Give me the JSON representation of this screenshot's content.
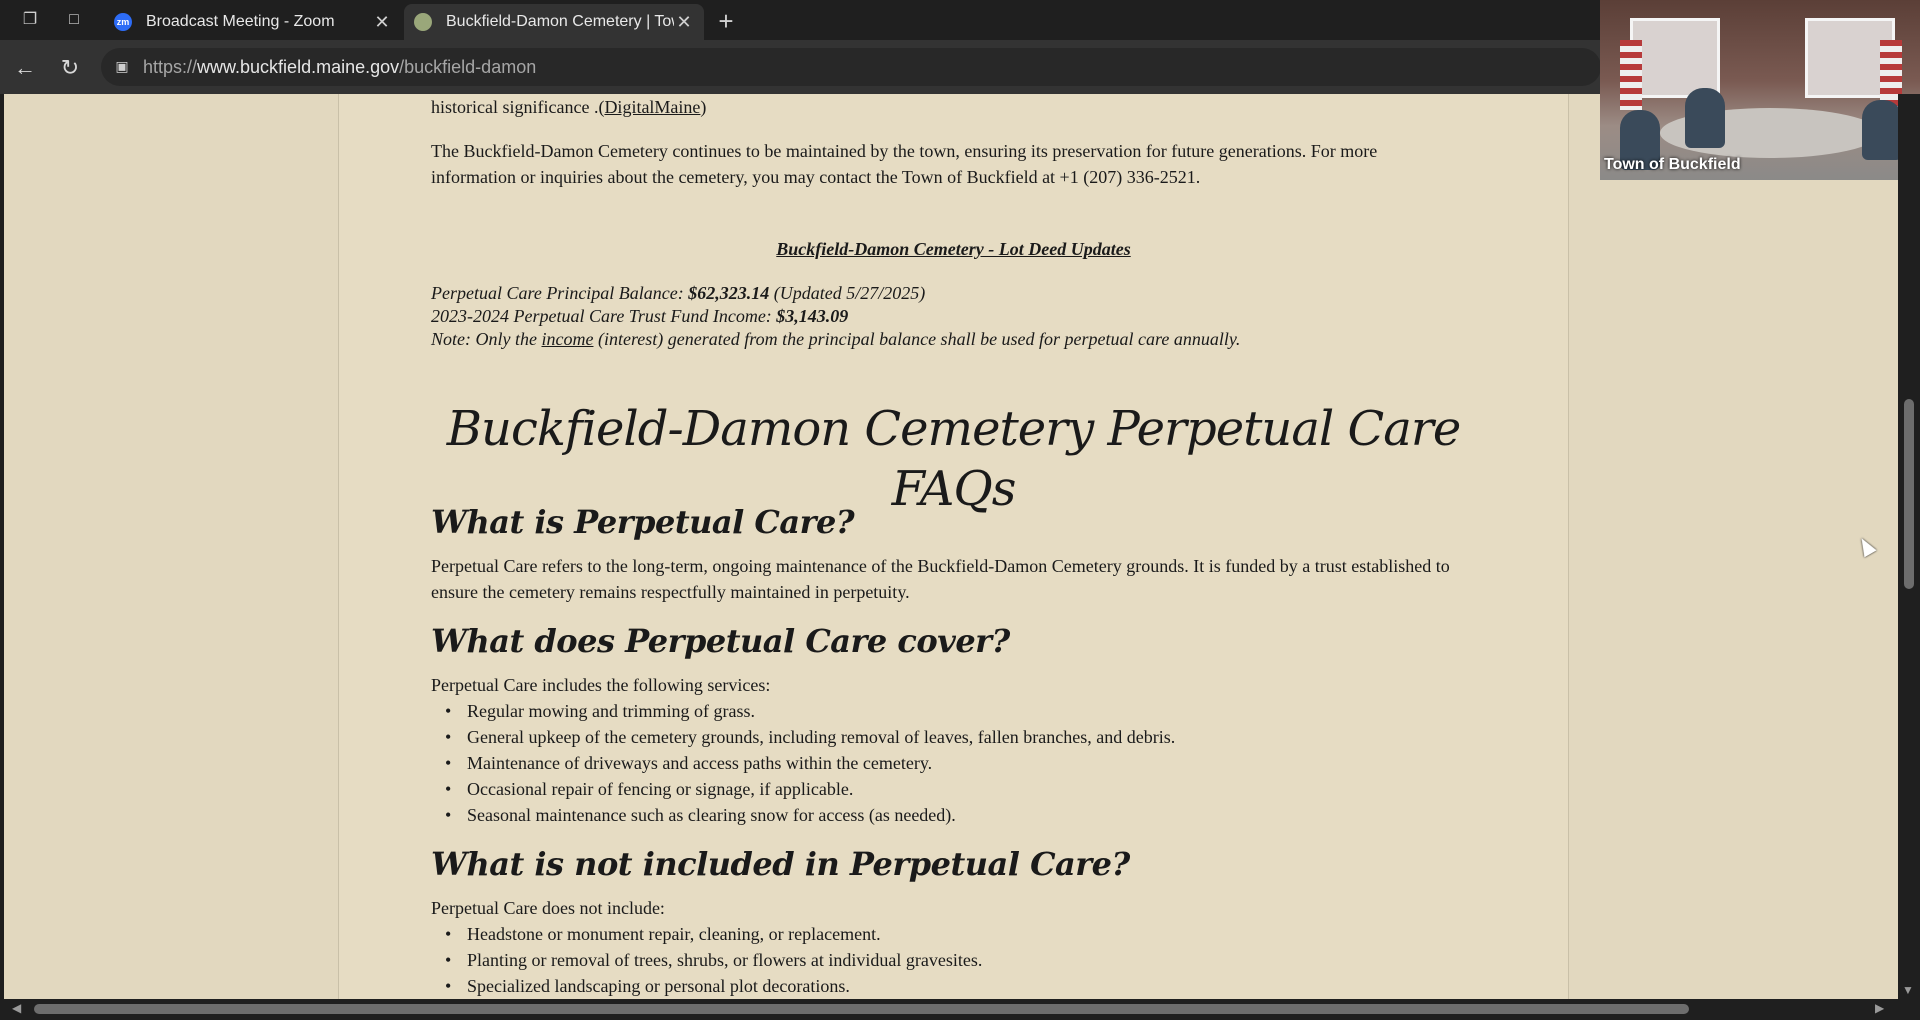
{
  "browser": {
    "tabs": [
      {
        "title": "Broadcast Meeting - Zoom",
        "favicon": "zm",
        "active": false
      },
      {
        "title": "Buckfield-Damon Cemetery | Tow",
        "favicon": "",
        "active": true
      }
    ],
    "url_prefix": "https://",
    "url_domain": "www.buckfield.maine.gov",
    "url_path": "/buckfield-damon"
  },
  "video": {
    "label": "Town of Buckfield"
  },
  "content": {
    "top_text": "historical significance .(",
    "top_link": "DigitalMaine",
    "top_close": ")",
    "maint_para": "The Buckfield-Damon Cemetery continues to be maintained by the town, ensuring its preservation for future generations. For more information or inquiries about the cemetery, you may contact the Town of Buckfield at +1 (207) 336-2521.",
    "lot_heading": "Buckfield-Damon Cemetery - Lot Deed Updates",
    "balance_label": "Perpetual Care Principal Balance: ",
    "balance_value": "$62,323.14",
    "balance_note": " (Updated 5/27/2025)",
    "income_label": "2023-2024 Perpetual Care Trust Fund Income: ",
    "income_value": "$3,143.09",
    "note_pre": "Note: Only the ",
    "note_link": "income",
    "note_post": " (interest) generated from the principal balance shall be used for perpetual care annually.",
    "faq_title": "Buckfield-Damon Cemetery Perpetual Care FAQs",
    "q1": "What is Perpetual Care?",
    "a1": "Perpetual Care refers to the long-term, ongoing maintenance of the Buckfield-Damon Cemetery grounds. It is funded by a trust established to ensure the cemetery remains respectfully maintained in perpetuity.",
    "q2": "What does Perpetual Care cover?",
    "a2_intro": "Perpetual Care includes the following services:",
    "a2_items": [
      "Regular mowing and trimming of grass.",
      "General upkeep of the cemetery grounds, including removal of leaves, fallen branches, and debris.",
      "Maintenance of driveways and access paths within the cemetery.",
      "Occasional repair of fencing or signage, if applicable.",
      "Seasonal maintenance such as clearing snow for access (as needed)."
    ],
    "q3": "What is not included in Perpetual Care?",
    "a3_intro": "Perpetual Care does not include:",
    "a3_items": [
      "Headstone or monument repair, cleaning, or replacement.",
      "Planting or removal of trees, shrubs, or flowers at individual gravesites.",
      "Specialized landscaping or personal plot decorations."
    ]
  },
  "colors": {
    "page_bg": "#e6dcc3",
    "chrome_bg": "#1f1f1f",
    "toolbar_bg": "#333333"
  }
}
